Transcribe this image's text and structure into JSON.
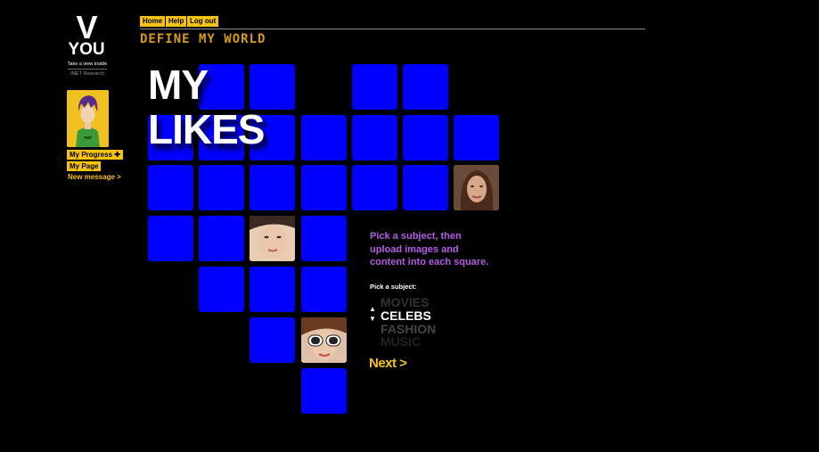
{
  "brand": {
    "logo_v": "V",
    "logo_you": "YOU",
    "tagline": "Take a view inside",
    "sub": "iMET Research"
  },
  "sidebar": {
    "progress_label": "My Progress",
    "progress_icon": "plus-icon",
    "mypage_label": "My Page",
    "message_link": "New message >"
  },
  "nav": {
    "home": "Home",
    "help": "Help",
    "logout": "Log out"
  },
  "section_title": "DEFINE MY WORLD",
  "heading": {
    "line1": "MY",
    "line2": "LIKES"
  },
  "panel": {
    "instruction": "Pick a subject, then upload images and content into each square.",
    "pick_label": "Pick a subject:",
    "options": [
      "MOVIES",
      "CELEBS",
      "FASHION",
      "MUSIC"
    ],
    "selected": "CELEBS",
    "next": "Next >"
  },
  "colors": {
    "square_blue": "#0000fe",
    "accent_yellow": "#f6c40f",
    "instruction_purple": "#b45de6",
    "title_orange": "#d79a16"
  }
}
